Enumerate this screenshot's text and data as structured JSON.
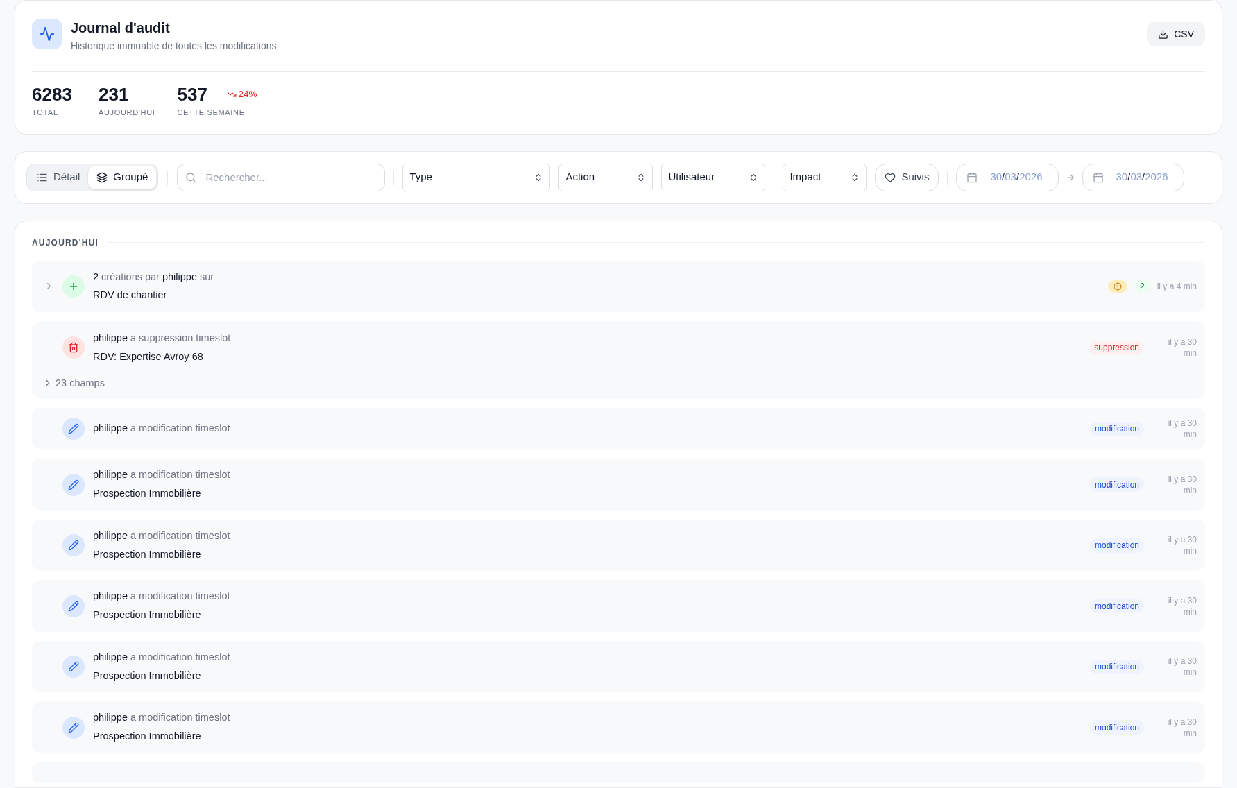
{
  "header": {
    "title": "Journal d'audit",
    "subtitle": "Historique immuable de toutes les modifications",
    "export_button": "CSV"
  },
  "stats": [
    {
      "value": "6283",
      "label": "TOTAL"
    },
    {
      "value": "231",
      "label": "AUJOURD'HUI"
    },
    {
      "value": "537",
      "label": "CETTE SEMAINE",
      "trend": {
        "kind": "down",
        "text": "24%"
      }
    }
  ],
  "filters": {
    "view_toggle": [
      {
        "label": "Détail",
        "selected": false
      },
      {
        "label": "Groupé",
        "selected": true
      }
    ],
    "search": {
      "placeholder": "Rechercher..."
    },
    "selects": [
      {
        "label": "Type"
      },
      {
        "label": "Action"
      },
      {
        "label": "Utilisateur"
      },
      {
        "label": "Impact"
      }
    ],
    "follow_button": "Suivis",
    "date_from": {
      "parts": [
        "30",
        "03",
        "2026"
      ],
      "separator": "/"
    },
    "date_to": {
      "parts": [
        "30",
        "03",
        "2026"
      ],
      "separator": "/"
    }
  },
  "sections": [
    {
      "title": "AUJOURD'HUI",
      "entries": [
        {
          "kind": "create",
          "expanded": false,
          "summary": "**2** créations par **philippe** sur",
          "target": "RDV de chantier",
          "warning": true,
          "count": "2",
          "time": "il y a 4 min"
        },
        {
          "kind": "delete",
          "summary": "**philippe** a suppression timeslot",
          "target": "RDV: Expertise Avroy 68",
          "badge": "suppression",
          "fields": "23 champs",
          "time": "il y a 30 min"
        },
        {
          "kind": "edit",
          "summary": "**philippe** a modification timeslot",
          "badge": "modification",
          "time": "il y a 30 min"
        },
        {
          "kind": "edit",
          "summary": "**philippe** a modification timeslot",
          "target": "Prospection Immobilière",
          "badge": "modification",
          "time": "il y a 30 min"
        },
        {
          "kind": "edit",
          "summary": "**philippe** a modification timeslot",
          "target": "Prospection Immobilière",
          "badge": "modification",
          "time": "il y a 30 min"
        },
        {
          "kind": "edit",
          "summary": "**philippe** a modification timeslot",
          "target": "Prospection Immobilière",
          "badge": "modification",
          "time": "il y a 30 min"
        },
        {
          "kind": "edit",
          "summary": "**philippe** a modification timeslot",
          "target": "Prospection Immobilière",
          "badge": "modification",
          "time": "il y a 30 min"
        },
        {
          "kind": "edit",
          "summary": "**philippe** a modification timeslot",
          "target": "Prospection Immobilière",
          "badge": "modification",
          "time": "il y a 30 min"
        },
        {
          "kind": "cut"
        }
      ]
    }
  ]
}
